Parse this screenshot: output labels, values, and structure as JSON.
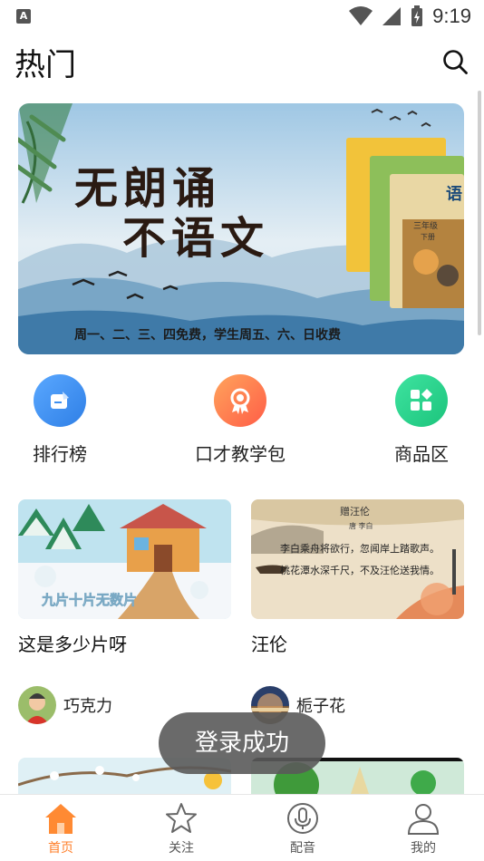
{
  "status_bar": {
    "time": "9:19",
    "app_indicator": "A"
  },
  "header": {
    "title": "热门",
    "search_icon": "search-icon"
  },
  "banner": {
    "headline_line1": "无朗诵",
    "headline_line2": "不语文",
    "subline": "周一、二、三、四免费，学生周五、六、日收费",
    "book_grade": "三年级",
    "book_term": "下册",
    "book_subject": "语"
  },
  "shortcuts": [
    {
      "label": "排行榜",
      "icon": "ranking-icon",
      "color": "#3d8ff0"
    },
    {
      "label": "口才教学包",
      "icon": "award-icon",
      "color": "#ff7a45"
    },
    {
      "label": "商品区",
      "icon": "grid-icon",
      "color": "#23cf8a"
    }
  ],
  "cards": [
    {
      "title": "这是多少片呀",
      "thumb_caption": "九片十片无数片",
      "author": "巧克力"
    },
    {
      "title": "汪伦",
      "poem_title": "赠汪伦",
      "poem_author": "唐 李白",
      "poem_line1": "李白乘舟将欲行，忽闻岸上踏歌声。",
      "poem_line2": "桃花潭水深千尺，不及汪伦送我情。",
      "author": "栀子花"
    }
  ],
  "toast": {
    "text": "登录成功"
  },
  "tabbar": {
    "tabs": [
      {
        "label": "首页",
        "icon": "home-icon",
        "active": true
      },
      {
        "label": "关注",
        "icon": "star-icon",
        "active": false
      },
      {
        "label": "配音",
        "icon": "microphone-icon",
        "active": false
      },
      {
        "label": "我的",
        "icon": "user-icon",
        "active": false
      }
    ],
    "active_color": "#ff7f2a"
  }
}
